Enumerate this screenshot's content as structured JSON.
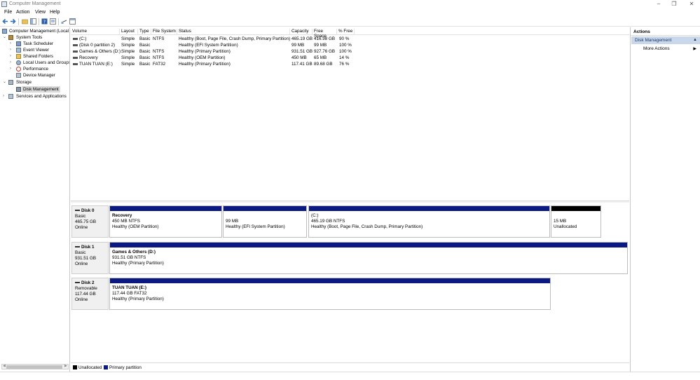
{
  "window": {
    "title": "Computer Management",
    "minimize": "–",
    "restore": "❐",
    "close": "✕"
  },
  "menu": [
    "File",
    "Action",
    "View",
    "Help"
  ],
  "toolbar": {
    "icons": [
      "back-icon",
      "forward-icon",
      "folder-up-icon",
      "show-tree-icon",
      "help-icon",
      "properties-icon",
      "connect-icon",
      "console-icon"
    ]
  },
  "tree": {
    "root": "Computer Management (Local",
    "system_tools": "System Tools",
    "task_scheduler": "Task Scheduler",
    "event_viewer": "Event Viewer",
    "shared_folders": "Shared Folders",
    "local_users": "Local Users and Groups",
    "performance": "Performance",
    "device_manager": "Device Manager",
    "storage": "Storage",
    "disk_management": "Disk Management",
    "services": "Services and Applications"
  },
  "volumes": {
    "headers": [
      "Volume",
      "Layout",
      "Type",
      "File System",
      "Status",
      "Capacity",
      "Free Space",
      "% Free"
    ],
    "rows": [
      [
        "(C:)",
        "Simple",
        "Basic",
        "NTFS",
        "Healthy (Boot, Page File, Crash Dump, Primary Partition)",
        "465.19 GB",
        "416.98 GB",
        "90 %"
      ],
      [
        "(Disk 0 partition 2)",
        "Simple",
        "Basic",
        "",
        "Healthy (EFI System Partition)",
        "99 MB",
        "99 MB",
        "100 %"
      ],
      [
        "Games & Others (D:)",
        "Simple",
        "Basic",
        "NTFS",
        "Healthy (Primary Partition)",
        "931.51 GB",
        "927.76 GB",
        "100 %"
      ],
      [
        "Recovery",
        "Simple",
        "Basic",
        "NTFS",
        "Healthy (OEM Partition)",
        "450 MB",
        "65 MB",
        "14 %"
      ],
      [
        "TUAN TUAN (E:)",
        "Simple",
        "Basic",
        "FAT32",
        "Healthy (Primary Partition)",
        "117.41 GB",
        "89.68 GB",
        "76 %"
      ]
    ]
  },
  "disks": [
    {
      "name": "Disk 0",
      "type": "Basic",
      "size": "465.75 GB",
      "status": "Online",
      "partitions": [
        {
          "name": "Recovery",
          "size": "450 MB NTFS",
          "status": "Healthy (OEM Partition)"
        },
        {
          "name": "",
          "size": "99 MB",
          "status": "Healthy (EFI System Partition)"
        },
        {
          "name": "(C:)",
          "size": "465.19 GB NTFS",
          "status": "Healthy (Boot, Page File, Crash Dump, Primary Partition)"
        },
        {
          "name": "",
          "size": "15 MB",
          "status": "Unallocated"
        }
      ]
    },
    {
      "name": "Disk 1",
      "type": "Basic",
      "size": "931.51 GB",
      "status": "Online",
      "partitions": [
        {
          "name": "Games & Others  (D:)",
          "size": "931.51 GB NTFS",
          "status": "Healthy (Primary Partition)"
        }
      ]
    },
    {
      "name": "Disk 2",
      "type": "Removable",
      "size": "117.44 GB",
      "status": "Online",
      "partitions": [
        {
          "name": "TUAN TUAN  (E:)",
          "size": "117.44 GB FAT32",
          "status": "Healthy (Primary Partition)"
        }
      ]
    }
  ],
  "legend": {
    "unallocated": "Unallocated",
    "primary": "Primary partition"
  },
  "colors": {
    "primary_partition": "#0a1a82",
    "unallocated": "#000000",
    "action_section": "#c9d7ea"
  },
  "actions": {
    "header": "Actions",
    "section": "Disk Management",
    "more": "More Actions"
  }
}
